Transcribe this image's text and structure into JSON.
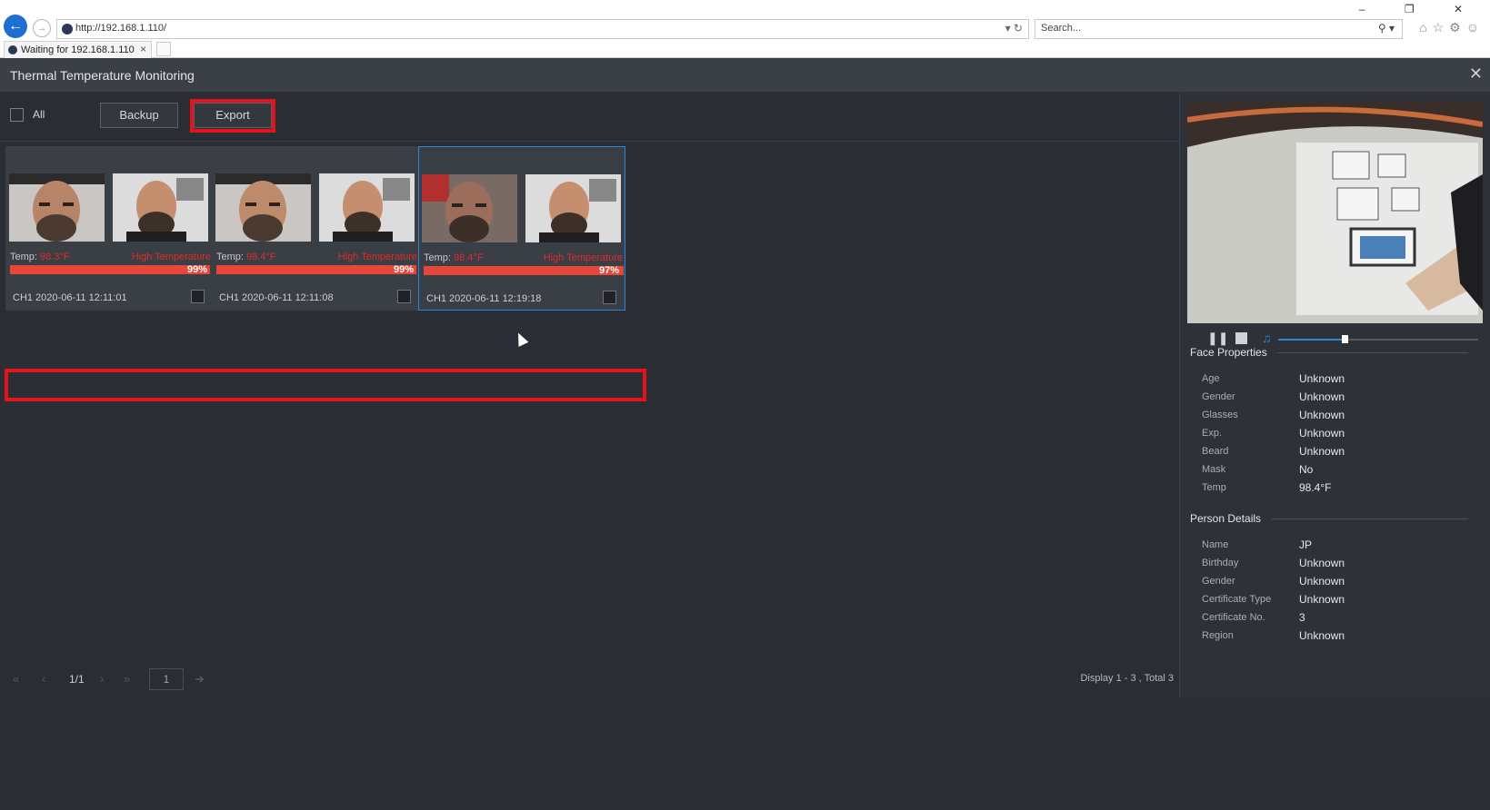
{
  "browser": {
    "url": "http://192.168.1.110/",
    "search_placeholder": "Search...",
    "tab_label": "Waiting for 192.168.1.110"
  },
  "app": {
    "title": "Thermal Temperature Monitoring"
  },
  "actions": {
    "all_label": "All",
    "backup_label": "Backup",
    "export_label": "Export"
  },
  "cards": [
    {
      "temp_label": "Temp:",
      "temp_value": "98.3°F",
      "alert": "High Temperature",
      "similarity": "99%",
      "caption": "CH1 2020-06-11 12:11:01",
      "selected": false
    },
    {
      "temp_label": "Temp:",
      "temp_value": "98.4°F",
      "alert": "High Temperature",
      "similarity": "99%",
      "caption": "CH1 2020-06-11 12:11:08",
      "selected": false
    },
    {
      "temp_label": "Temp:",
      "temp_value": "98.4°F",
      "alert": "High Temperature",
      "similarity": "97%",
      "caption": "CH1 2020-06-11 12:19:18",
      "selected": true
    }
  ],
  "pager": {
    "page_text": "1/1",
    "page_input": "1",
    "display_text": "Display 1 - 3 , Total 3"
  },
  "playback": {
    "volume_fraction": 0.33
  },
  "face_properties": {
    "title": "Face Properties",
    "rows": [
      {
        "key": "Age",
        "value": "Unknown"
      },
      {
        "key": "Gender",
        "value": "Unknown"
      },
      {
        "key": "Glasses",
        "value": "Unknown"
      },
      {
        "key": "Exp.",
        "value": "Unknown"
      },
      {
        "key": "Beard",
        "value": "Unknown"
      },
      {
        "key": "Mask",
        "value": "No"
      },
      {
        "key": "Temp",
        "value": "98.4°F"
      }
    ]
  },
  "person_details": {
    "title": "Person Details",
    "rows": [
      {
        "key": "Name",
        "value": "JP"
      },
      {
        "key": "Birthday",
        "value": "Unknown"
      },
      {
        "key": "Gender",
        "value": "Unknown"
      },
      {
        "key": "Certificate Type",
        "value": "Unknown"
      },
      {
        "key": "Certificate No.",
        "value": "3"
      },
      {
        "key": "Region",
        "value": "Unknown"
      }
    ]
  },
  "colors": {
    "alert_red": "#e12a2a",
    "highlight_red": "#e3131c",
    "accent_blue": "#2b86d6"
  }
}
